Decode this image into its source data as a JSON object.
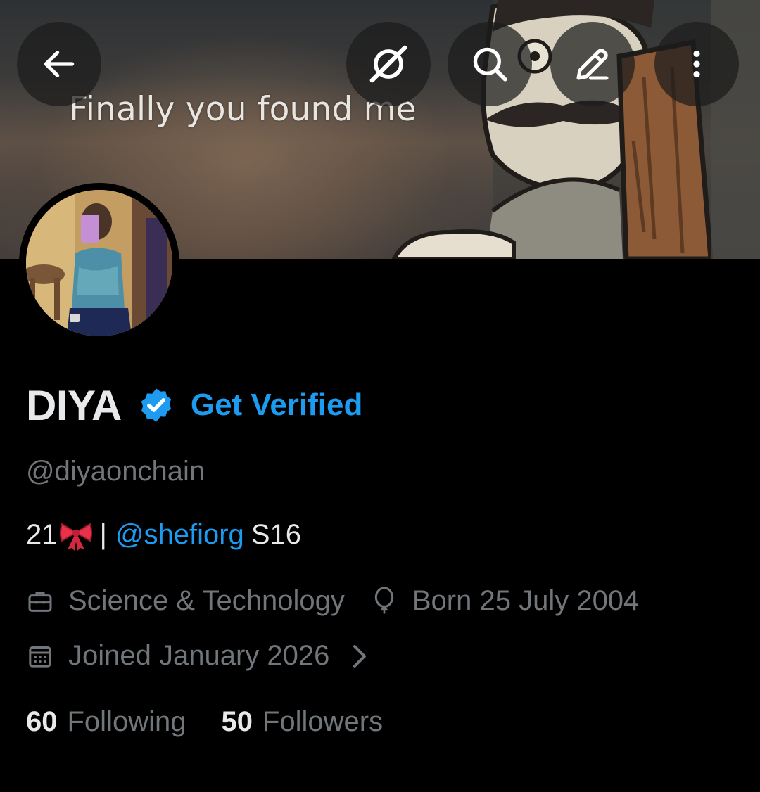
{
  "banner": {
    "caption": "Finally you found me"
  },
  "header_actions": {
    "back": "arrow-left-icon",
    "grok": "grok-icon",
    "search": "search-icon",
    "edit": "edit-icon",
    "more": "more-vertical-icon"
  },
  "profile": {
    "display_name": "DIYA",
    "verified_badge_icon": "verified-badge-icon",
    "get_verified_label": "Get Verified",
    "handle": "@diyaonchain",
    "bio": {
      "prefix": "21",
      "emoji_icon": "ribbon-emoji",
      "separator": "|",
      "mention": "@shefiorg",
      "suffix": "S16"
    },
    "category": "Science & Technology",
    "birthday": "Born 25 July 2004",
    "joined": "Joined January 2026",
    "following_count": "60",
    "following_label": "Following",
    "followers_count": "50",
    "followers_label": "Followers"
  },
  "colors": {
    "background": "#000000",
    "primary_text": "#e7e9ea",
    "secondary_text": "#71767b",
    "accent_blue": "#1d9bf0"
  }
}
